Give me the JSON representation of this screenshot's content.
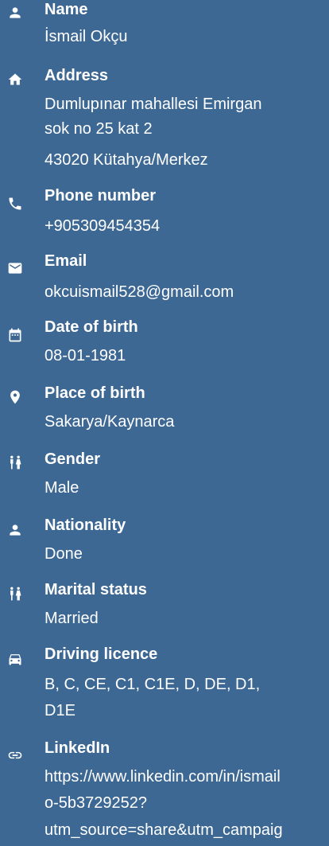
{
  "fields": [
    {
      "icon": "person-icon",
      "label": "Name",
      "value": "İsmail Okçu"
    },
    {
      "icon": "home-icon",
      "label": "Address",
      "value_lines": [
        "Dumlupınar mahallesi Emirgan",
        "sok no 25 kat 2",
        "43020 Kütahya/Merkez"
      ]
    },
    {
      "icon": "phone-icon",
      "label": "Phone number",
      "value": "+905309454354"
    },
    {
      "icon": "mail-icon",
      "label": "Email",
      "value": "okcuismail528@gmail.com"
    },
    {
      "icon": "calendar-icon",
      "label": "Date of birth",
      "value": "08-01-1981"
    },
    {
      "icon": "location-pin-icon",
      "label": "Place of birth",
      "value": "Sakarya/Kaynarca"
    },
    {
      "icon": "people-icon",
      "label": "Gender",
      "value": "Male"
    },
    {
      "icon": "person-icon",
      "label": "Nationality",
      "value": "Done"
    },
    {
      "icon": "people-icon",
      "label": "Marital status",
      "value": "Married"
    },
    {
      "icon": "car-icon",
      "label": "Driving licence",
      "value_lines": [
        "B, C, CE, C1, C1E, D, DE, D1,",
        "D1E"
      ]
    },
    {
      "icon": "link-icon",
      "label": "LinkedIn",
      "value_lines": [
        "https://www.linkedin.com/in/ismail",
        "o-5b3729252?",
        "utm_source=share&utm_campaig"
      ]
    }
  ]
}
